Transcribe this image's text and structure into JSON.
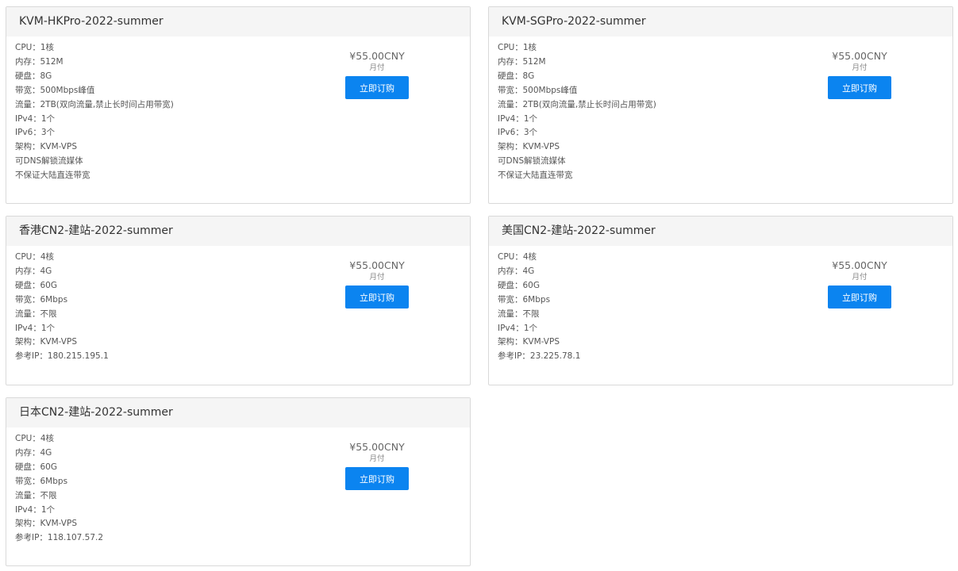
{
  "products": [
    {
      "title": "KVM-HKPro-2022-summer",
      "specs": [
        "CPU：1核",
        "内存：512M",
        "硬盘：8G",
        "带宽：500Mbps峰值",
        "流量：2TB(双向流量,禁止长时间占用带宽)",
        "IPv4：1个",
        "IPv6：3个",
        "架构：KVM-VPS",
        "可DNS解锁流媒体",
        "不保证大陆直连带宽"
      ],
      "price": "¥55.00CNY",
      "period": "月付",
      "button": "立即订购"
    },
    {
      "title": "KVM-SGPro-2022-summer",
      "specs": [
        "CPU：1核",
        "内存：512M",
        "硬盘：8G",
        "带宽：500Mbps峰值",
        "流量：2TB(双向流量,禁止长时间占用带宽)",
        "IPv4：1个",
        "IPv6：3个",
        "架构：KVM-VPS",
        "可DNS解锁流媒体",
        "不保证大陆直连带宽"
      ],
      "price": "¥55.00CNY",
      "period": "月付",
      "button": "立即订购"
    },
    {
      "title": "香港CN2-建站-2022-summer",
      "specs": [
        "CPU：4核",
        "内存：4G",
        "硬盘：60G",
        "带宽：6Mbps",
        "流量：不限",
        "IPv4：1个",
        "架构：KVM-VPS",
        "参考IP：180.215.195.1"
      ],
      "price": "¥55.00CNY",
      "period": "月付",
      "button": "立即订购"
    },
    {
      "title": "美国CN2-建站-2022-summer",
      "specs": [
        "CPU：4核",
        "内存：4G",
        "硬盘：60G",
        "带宽：6Mbps",
        "流量：不限",
        "IPv4：1个",
        "架构：KVM-VPS",
        "参考IP：23.225.78.1"
      ],
      "price": "¥55.00CNY",
      "period": "月付",
      "button": "立即订购"
    },
    {
      "title": "日本CN2-建站-2022-summer",
      "specs": [
        "CPU：4核",
        "内存：4G",
        "硬盘：60G",
        "带宽：6Mbps",
        "流量：不限",
        "IPv4：1个",
        "架构：KVM-VPS",
        "参考IP：118.107.57.2"
      ],
      "price": "¥55.00CNY",
      "period": "月付",
      "button": "立即订购"
    }
  ],
  "colors": {
    "accent": "#0b84f0",
    "header_bg": "#f5f5f5",
    "border": "#d9d9d9"
  }
}
